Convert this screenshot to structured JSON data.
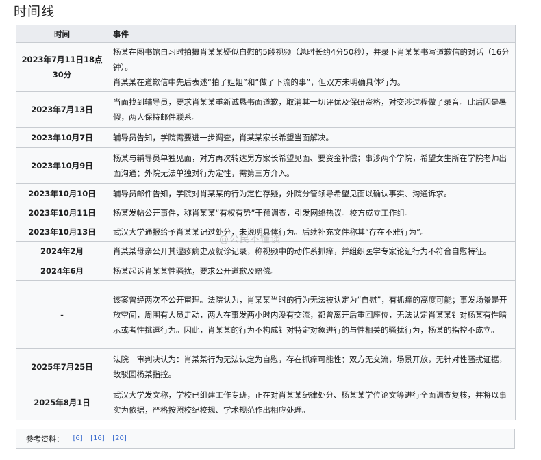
{
  "page": {
    "title": "时间线"
  },
  "table": {
    "headers": {
      "time": "时间",
      "event": "事件"
    },
    "rows": [
      {
        "time": "2023年7月11日18点30分",
        "event_lines": [
          "杨某在图书馆自习时拍摄肖某某疑似自慰的5段视频（总时长约4分50秒），并录下肖某某书写道歉信的对话（16分钟）。",
          "肖某某在道歉信中先后表述“拍了姐姐”和“做了下流的事”，但双方未明确具体行为。"
        ]
      },
      {
        "time": "2023年7月13日",
        "event_lines": [
          "当面找到辅导员，要求肖某某重新诚恳书面道歉，取消其一切评优及保研资格，对交涉过程做了录音。此后因是暑假，两人保持邮件联系。"
        ]
      },
      {
        "time": "2023年10月7日",
        "event_lines": [
          "辅导员告知，学院需要进一步调查，肖某某家长希望当面解决。"
        ]
      },
      {
        "time": "2023年10月9日",
        "event_lines": [
          "杨某与辅导员单独见面，对方再次转达男方家长希望见面、要资金补偿；事涉两个学院，希望女生所在学院老师出面沟通；外院无法单独对行为定性，需第三方介入。"
        ]
      },
      {
        "time": "2023年10月10日",
        "event_lines": [
          "辅导员邮件告知，学院对肖某某的行为定性存疑，外院分管领导希望见面以确认事实、沟通诉求。"
        ]
      },
      {
        "time": "2023年10月11日",
        "event_lines": [
          "杨某发帖公开事件，称肖某某“有权有势”干预调查，引发网络热议。校方成立工作组。"
        ]
      },
      {
        "time": "2023年10月13日",
        "event_lines": [
          "武汉大学通报给予肖某某记过处分，未说明具体行为。后续补充文件称其“存在不雅行为”。"
        ]
      },
      {
        "time": "2024年2月",
        "event_lines": [
          "肖某某母亲公开其湿疹病史及就诊记录，称视频中的动作系抓痒，并组织医学专家论证行为不符合自慰特征。"
        ]
      },
      {
        "time": "2024年6月",
        "event_lines": [
          "杨某起诉肖某某性骚扰，要求公开道歉及赔偿。"
        ]
      },
      {
        "time": "-",
        "event_lines": [
          "该案曾经两次不公开审理。法院认为，肖某某当时的行为无法被认定为“自慰”，有抓痒的高度可能；事发场景是开放空间，周围有人员走动，两人在事发两小时内没有交流，都曾离开后重回座位，无法认定肖某某针对杨某有性暗示或者性挑逗行为。因此，肖某某的行为不构成针对特定对象进行的与性相关的骚扰行为，杨某的指控不成立。"
        ]
      },
      {
        "time": "2025年7月25日",
        "event_lines": [
          "法院一审判决认为：肖某某行为无法认定为自慰，存在抓痒可能性；双方无交流，场景开放，无针对性骚扰证据，故驳回杨某指控。"
        ]
      },
      {
        "time": "2025年8月1日",
        "event_lines": [
          "武汉大学发文称，学校已组建工作专班，正在对肖某某纪律处分、杨某某学位论文等进行全面调查复核，并将以事实为依据，严格按照校纪校规、学术规范作出相应处理。"
        ]
      }
    ]
  },
  "references": {
    "label": "参考资料：",
    "links": [
      "[6]",
      "[16]",
      "[20]"
    ]
  },
  "watermark": {
    "text": "@公民不懂谈"
  }
}
